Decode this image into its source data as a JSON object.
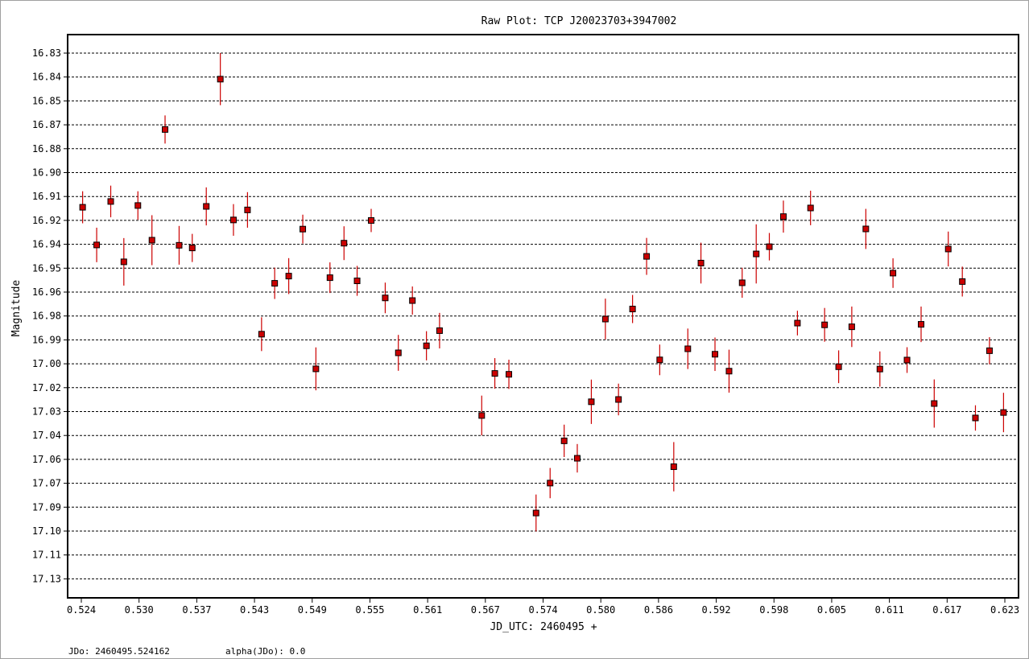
{
  "chart_data": {
    "type": "scatter",
    "title": "Raw Plot: TCP J20023703+3947002",
    "xlabel": "JD_UTC: 2460495 +",
    "ylabel": "Magnitude",
    "y_inverted": true,
    "grid": "horizontal-dashed",
    "xlim": [
      0.5225,
      0.624
    ],
    "ylim": [
      16.818,
      17.138
    ],
    "x_ticks": [
      "0.524",
      "0.530",
      "0.537",
      "0.543",
      "0.549",
      "0.555",
      "0.561",
      "0.567",
      "0.574",
      "0.580",
      "0.586",
      "0.592",
      "0.598",
      "0.605",
      "0.611",
      "0.617",
      "0.623"
    ],
    "y_ticks": [
      "16.83",
      "16.84",
      "16.85",
      "16.87",
      "16.88",
      "16.90",
      "16.91",
      "16.92",
      "16.94",
      "16.95",
      "16.96",
      "16.98",
      "16.99",
      "17.00",
      "17.02",
      "17.03",
      "17.04",
      "17.06",
      "17.07",
      "17.09",
      "17.10",
      "17.11",
      "17.13"
    ],
    "marker_color": "#cc0000",
    "errorbar_color": "#cc0000",
    "points": [
      {
        "x": 0.5241,
        "y": 16.9161,
        "err": 0.0091
      },
      {
        "x": 0.5256,
        "y": 16.9375,
        "err": 0.0098
      },
      {
        "x": 0.5271,
        "y": 16.9128,
        "err": 0.009
      },
      {
        "x": 0.5285,
        "y": 16.9471,
        "err": 0.0135
      },
      {
        "x": 0.53,
        "y": 16.9151,
        "err": 0.0081
      },
      {
        "x": 0.5315,
        "y": 16.9348,
        "err": 0.0142
      },
      {
        "x": 0.5329,
        "y": 16.8719,
        "err": 0.008
      },
      {
        "x": 0.5344,
        "y": 16.9377,
        "err": 0.011
      },
      {
        "x": 0.5358,
        "y": 16.9392,
        "err": 0.008
      },
      {
        "x": 0.5373,
        "y": 16.9156,
        "err": 0.0108
      },
      {
        "x": 0.5388,
        "y": 16.8433,
        "err": 0.0148
      },
      {
        "x": 0.5402,
        "y": 16.9233,
        "err": 0.009
      },
      {
        "x": 0.5417,
        "y": 16.9176,
        "err": 0.0101
      },
      {
        "x": 0.5432,
        "y": 16.9882,
        "err": 0.0096
      },
      {
        "x": 0.5446,
        "y": 16.9593,
        "err": 0.0089
      },
      {
        "x": 0.5461,
        "y": 16.9552,
        "err": 0.0102
      },
      {
        "x": 0.5476,
        "y": 16.9285,
        "err": 0.0082
      },
      {
        "x": 0.549,
        "y": 17.0079,
        "err": 0.0122
      },
      {
        "x": 0.5505,
        "y": 16.9561,
        "err": 0.0087
      },
      {
        "x": 0.552,
        "y": 16.9365,
        "err": 0.0096
      },
      {
        "x": 0.5534,
        "y": 16.9579,
        "err": 0.0085
      },
      {
        "x": 0.5549,
        "y": 16.9236,
        "err": 0.0066
      },
      {
        "x": 0.5564,
        "y": 16.9676,
        "err": 0.0087
      },
      {
        "x": 0.5578,
        "y": 16.9988,
        "err": 0.0102
      },
      {
        "x": 0.5593,
        "y": 16.9691,
        "err": 0.008
      },
      {
        "x": 0.5608,
        "y": 16.9948,
        "err": 0.0083
      },
      {
        "x": 0.5622,
        "y": 16.9862,
        "err": 0.0101
      },
      {
        "x": 0.5667,
        "y": 17.0344,
        "err": 0.0113
      },
      {
        "x": 0.5681,
        "y": 17.0105,
        "err": 0.0087
      },
      {
        "x": 0.5696,
        "y": 17.011,
        "err": 0.0083
      },
      {
        "x": 0.5725,
        "y": 17.0898,
        "err": 0.0105
      },
      {
        "x": 0.574,
        "y": 17.0728,
        "err": 0.0086
      },
      {
        "x": 0.5755,
        "y": 17.0488,
        "err": 0.0092
      },
      {
        "x": 0.5769,
        "y": 17.0587,
        "err": 0.0081
      },
      {
        "x": 0.5784,
        "y": 17.0266,
        "err": 0.0126
      },
      {
        "x": 0.5799,
        "y": 16.9796,
        "err": 0.0116
      },
      {
        "x": 0.5813,
        "y": 17.0253,
        "err": 0.009
      },
      {
        "x": 0.5828,
        "y": 16.9739,
        "err": 0.008
      },
      {
        "x": 0.5843,
        "y": 16.944,
        "err": 0.0105
      },
      {
        "x": 0.5857,
        "y": 17.0028,
        "err": 0.0087
      },
      {
        "x": 0.5872,
        "y": 17.0635,
        "err": 0.014
      },
      {
        "x": 0.5887,
        "y": 16.9965,
        "err": 0.0115
      },
      {
        "x": 0.5901,
        "y": 16.9478,
        "err": 0.0116
      },
      {
        "x": 0.5916,
        "y": 16.9996,
        "err": 0.0095
      },
      {
        "x": 0.5931,
        "y": 17.0092,
        "err": 0.0122
      },
      {
        "x": 0.5945,
        "y": 16.959,
        "err": 0.0085
      },
      {
        "x": 0.596,
        "y": 16.9426,
        "err": 0.0168
      },
      {
        "x": 0.5974,
        "y": 16.9385,
        "err": 0.0078
      },
      {
        "x": 0.5989,
        "y": 16.9214,
        "err": 0.0091
      },
      {
        "x": 0.6004,
        "y": 16.9819,
        "err": 0.007
      },
      {
        "x": 0.6018,
        "y": 16.9165,
        "err": 0.0098
      },
      {
        "x": 0.6033,
        "y": 16.9829,
        "err": 0.0096
      },
      {
        "x": 0.6048,
        "y": 17.0067,
        "err": 0.0093
      },
      {
        "x": 0.6062,
        "y": 16.984,
        "err": 0.0115
      },
      {
        "x": 0.6077,
        "y": 16.9284,
        "err": 0.0114
      },
      {
        "x": 0.6092,
        "y": 17.008,
        "err": 0.01
      },
      {
        "x": 0.6106,
        "y": 16.9535,
        "err": 0.0084
      },
      {
        "x": 0.6121,
        "y": 17.0029,
        "err": 0.0073
      },
      {
        "x": 0.6136,
        "y": 16.9826,
        "err": 0.0101
      },
      {
        "x": 0.615,
        "y": 17.0276,
        "err": 0.0137
      },
      {
        "x": 0.6165,
        "y": 16.9398,
        "err": 0.0099
      },
      {
        "x": 0.618,
        "y": 16.9583,
        "err": 0.0085
      },
      {
        "x": 0.6194,
        "y": 17.0358,
        "err": 0.0072
      },
      {
        "x": 0.6209,
        "y": 16.9976,
        "err": 0.0077
      },
      {
        "x": 0.6224,
        "y": 17.0327,
        "err": 0.0112
      }
    ]
  },
  "footer": {
    "jdo": "JDo: 2460495.524162",
    "alpha": "alpha(JDo): 0.0"
  }
}
